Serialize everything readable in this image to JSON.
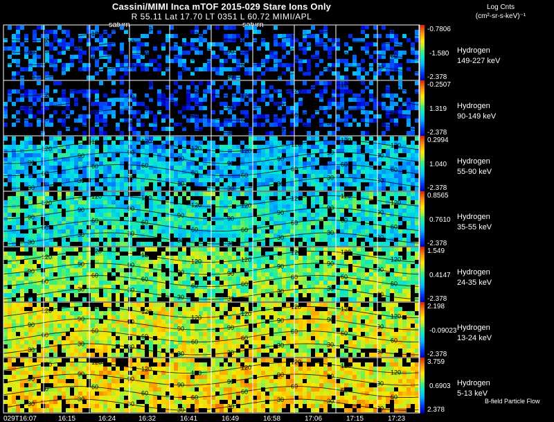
{
  "header": {
    "title": "Cassini/MIMI Inca mTOF  2015-029   Stare   Ions Only",
    "subtitle": "R       55.11 Lat 17.70 LT 0351 L          60.72  MIMI/APL",
    "markers": [
      "saturn",
      "saturn"
    ]
  },
  "colorbar": {
    "title_line1": "Log Cnts",
    "title_line2": "(cm²-sr-s-keV)⁻¹"
  },
  "footer": {
    "flow_label": "B-field Particle Flow"
  },
  "chart_data": {
    "type": "heatmap",
    "title": "Cassini/MIMI Inca mTOF  2015-029   Stare   Ions Only",
    "x_tick_labels": [
      "029T16:07",
      "16:15",
      "16:24",
      "16:32",
      "16:41",
      "16:49",
      "16:58",
      "17:06",
      "17:15",
      "17:23"
    ],
    "contour_labels": [
      "30",
      "60",
      "90",
      "120",
      "150"
    ],
    "panels": [
      {
        "species": "Hydrogen",
        "energy": "149-227 keV",
        "max": "-0.7806",
        "mid": "-1.580",
        "min": "-2.378",
        "level": 0.18
      },
      {
        "species": "Hydrogen",
        "energy": "90-149 keV",
        "max": "-0.2507",
        "mid": "1.319",
        "min": "-2.378",
        "level": 0.15
      },
      {
        "species": "Hydrogen",
        "energy": "55-90 keV",
        "max": "0.2994",
        "mid": "1.040",
        "min": "-2.378",
        "level": 0.32
      },
      {
        "species": "Hydrogen",
        "energy": "35-55 keV",
        "max": "0.8565",
        "mid": "0.7610",
        "min": "-2.378",
        "level": 0.42
      },
      {
        "species": "Hydrogen",
        "energy": "24-35 keV",
        "max": "1.549",
        "mid": "0.4147",
        "min": "-2.378",
        "level": 0.55
      },
      {
        "species": "Hydrogen",
        "energy": "13-24 keV",
        "max": "2.198",
        "mid": "-0.09023",
        "min": "-2.378",
        "level": 0.66
      },
      {
        "species": "Hydrogen",
        "energy": "5-13 keV",
        "max": "3.759",
        "mid": "0.6903",
        "min": "2.378",
        "level": 0.72
      }
    ]
  }
}
